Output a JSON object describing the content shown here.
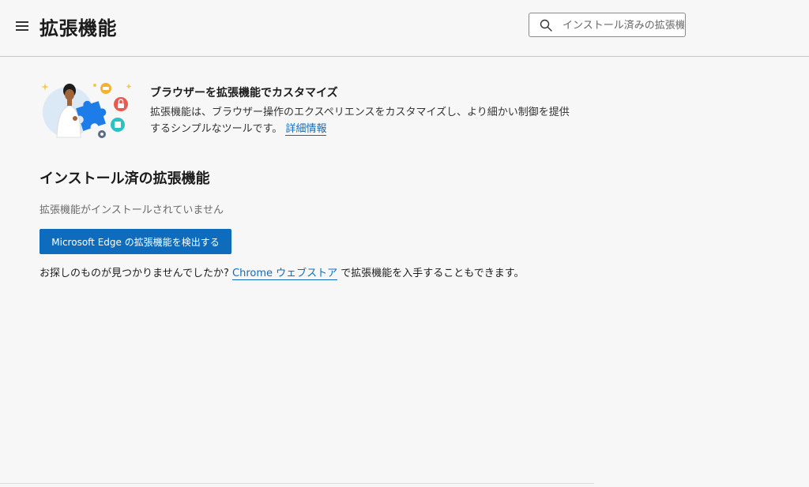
{
  "header": {
    "title": "拡張機能",
    "search_placeholder": "インストール済みの拡張機能"
  },
  "promo": {
    "title": "ブラウザーを拡張機能でカスタマイズ",
    "description": "拡張機能は、ブラウザー操作のエクスペリエンスをカスタマイズし、より細かい制御を提供するシンプルなツールです。",
    "learn_more": "詳細情報"
  },
  "installed": {
    "title": "インストール済の拡張機能",
    "empty_message": "拡張機能がインストールされていません",
    "discover_button": "Microsoft Edge の拡張機能を検出する"
  },
  "footer": {
    "prefix": "お探しのものが見つかりませんでしたか? ",
    "store_link": "Chrome ウェブストア",
    "suffix": " で拡張機能を入手することもできます。"
  },
  "colors": {
    "accent": "#0f6cbd",
    "background": "#f7f7f7"
  }
}
